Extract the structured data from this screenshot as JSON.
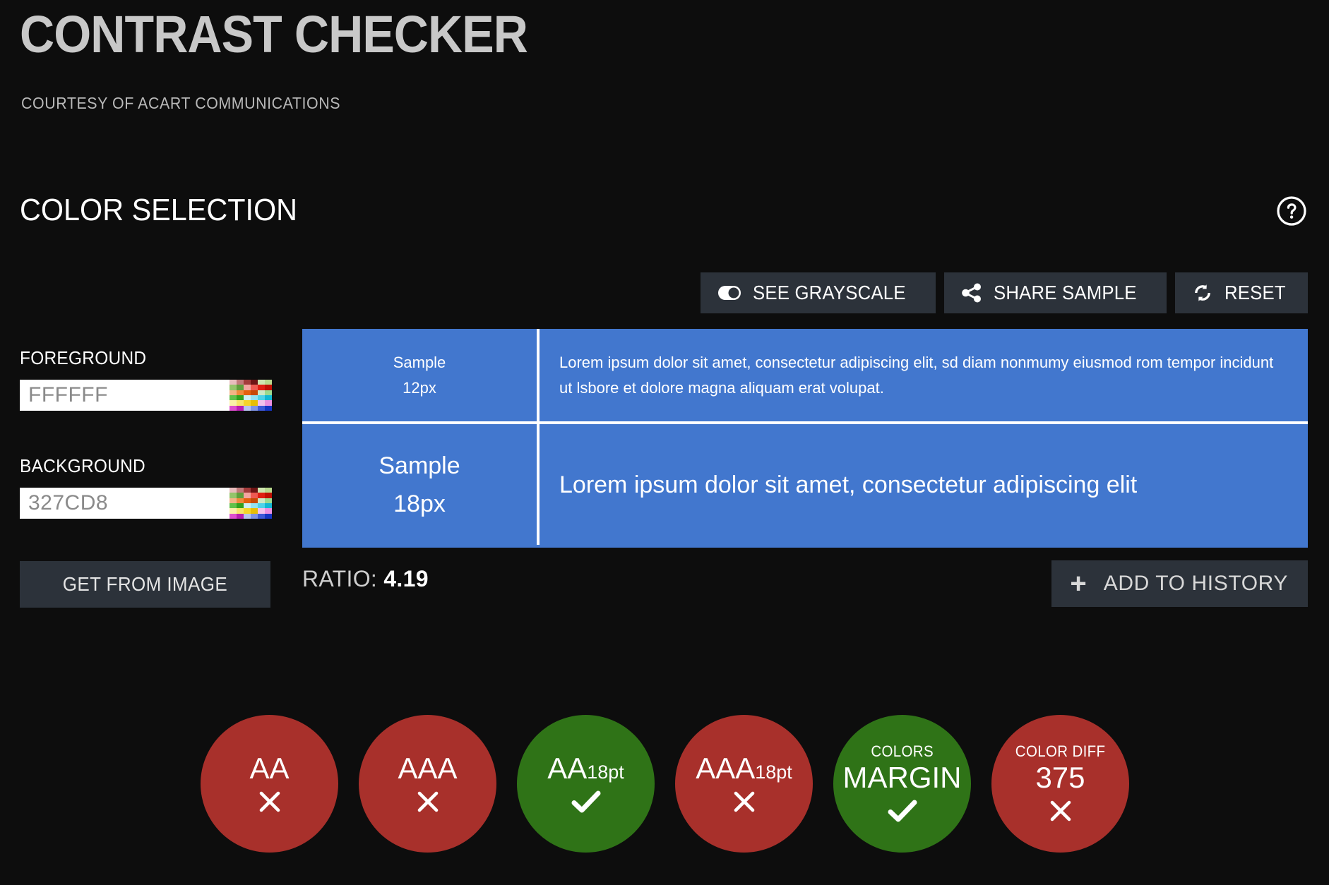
{
  "app": {
    "title": "CONTRAST CHECKER",
    "subtitle": "COURTESY OF ACART COMMUNICATIONS"
  },
  "section": {
    "title": "COLOR SELECTION",
    "help_icon": "question-mark-circle-icon"
  },
  "toolbar": {
    "grayscale_label": "SEE GRAYSCALE",
    "grayscale_icon": "toggle-switch-icon",
    "share_label": "SHARE SAMPLE",
    "share_icon": "share-nodes-icon",
    "reset_label": "RESET",
    "reset_icon": "refresh-sync-icon"
  },
  "colors": {
    "foreground_label": "FOREGROUND",
    "foreground_value": "FFFFFF",
    "foreground_placeholder": "FFFFFF",
    "background_label": "BACKGROUND",
    "background_value": "327CD8",
    "background_placeholder": "327CD8",
    "get_from_image_label": "GET FROM IMAGE",
    "swatch_icon": "color-palette-grid-icon",
    "palette": [
      "#e8bdbd",
      "#c27a7a",
      "#a43b3b",
      "#6e1414",
      "#cfe6b0",
      "#b8d98d",
      "#94c46a",
      "#5f9e3b",
      "#f3a5a0",
      "#ef5a52",
      "#e01f12",
      "#c01004",
      "#f3b486",
      "#ef8a3c",
      "#e2600f",
      "#c74a06",
      "#cfe9c7",
      "#9cd98e",
      "#62c14a",
      "#33a01d",
      "#cdeef3",
      "#93e2ef",
      "#4fd3e8",
      "#12b8d4",
      "#faf0a8",
      "#f7e46a",
      "#f5d42a",
      "#e8be05",
      "#f4c2ec",
      "#ec8fe0",
      "#dd4fcd",
      "#b81fb0",
      "#b6c3ef",
      "#7f93e3",
      "#3f59d6",
      "#1534c2",
      "#f6d5d6",
      "#eeaab4",
      "#e06080",
      "#c32f56",
      "#d8d8d8",
      "#9a9a9a",
      "#5a5a5a",
      "#000000",
      "#6b2e2e",
      "#8a4a1f",
      "#b8860b",
      "#8a6d0a"
    ]
  },
  "sample": {
    "preview_bg": "#4277ce",
    "preview_fg": "#ffffff",
    "rows": [
      {
        "label_line1": "Sample",
        "label_line2": "12px",
        "text": "Lorem ipsum dolor sit amet, consectetur adipiscing elit, sd diam nonmumy eiusmod rom tempor incidunt ut lsbore et dolore magna aliquam erat volupat."
      },
      {
        "label_line1": "Sample",
        "label_line2": "18px",
        "text": "Lorem ipsum dolor sit amet, consectetur adipiscing elit"
      }
    ]
  },
  "results": {
    "ratio_label": "RATIO:",
    "ratio_value": "4.19",
    "add_history_label": "ADD TO HISTORY",
    "add_history_icon": "plus-icon",
    "fail_color": "#a8302b",
    "pass_color": "#2f7317",
    "badges": [
      {
        "caption": "",
        "main": "AA",
        "sub": "",
        "status": "fail",
        "mark": "cross-icon"
      },
      {
        "caption": "",
        "main": "AAA",
        "sub": "",
        "status": "fail",
        "mark": "cross-icon"
      },
      {
        "caption": "",
        "main": "AA",
        "sub": "18pt",
        "status": "pass",
        "mark": "check-icon"
      },
      {
        "caption": "",
        "main": "AAA",
        "sub": "18pt",
        "status": "fail",
        "mark": "cross-icon"
      },
      {
        "caption": "COLORS",
        "main": "MARGIN",
        "sub": "",
        "status": "pass",
        "mark": "check-icon"
      },
      {
        "caption": "COLOR DIFF",
        "main": "375",
        "sub": "",
        "status": "fail",
        "mark": "cross-icon"
      }
    ]
  }
}
